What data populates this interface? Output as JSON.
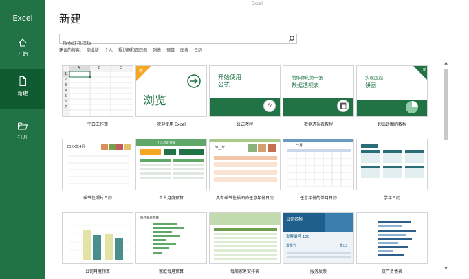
{
  "window": {
    "title": "Excel"
  },
  "sidebar": {
    "brand": "Excel",
    "items": [
      {
        "label": "开始",
        "icon": "home-icon",
        "active": false
      },
      {
        "label": "新建",
        "icon": "new-document-icon",
        "active": true
      },
      {
        "label": "打开",
        "icon": "open-folder-icon",
        "active": false
      }
    ]
  },
  "main": {
    "title": "新建",
    "search": {
      "placeholder": "搜索联机模板",
      "icon": "search-icon"
    },
    "suggestions": {
      "label": "建议的搜索:",
      "items": [
        "商业版",
        "个人",
        "规划器和跟踪器",
        "列表",
        "预算",
        "图表",
        "日历"
      ]
    }
  },
  "blank_workbook": {
    "col_headers": [
      "A",
      "B",
      "C"
    ],
    "row_headers": [
      "1",
      "2",
      "3",
      "4",
      "5",
      "6",
      "7"
    ]
  },
  "featured": {
    "tour": {
      "badge": "新",
      "title": "浏览"
    },
    "formula": {
      "line1": "开始使用",
      "line2": "公式",
      "icon": "fx"
    },
    "pivot": {
      "line1": "制作你的第一张",
      "line2": "数据透视表"
    },
    "pie": {
      "line1": "实现超越",
      "line2": "饼图"
    }
  },
  "calendar_previews": {
    "photo": "20XX年4月",
    "family": "20__年",
    "monthly": "一月",
    "budget_header": "个人月度预算"
  },
  "row3_previews": {
    "monthly_budget": "每月家庭预算",
    "company": {
      "name": "公司名称",
      "invoice": "发票编号 100",
      "seller": "发票方",
      "buyer": "售出"
    }
  },
  "templates": [
    {
      "caption": "空白工作簿"
    },
    {
      "caption": "欢迎使用 Excel"
    },
    {
      "caption": "公式教程"
    },
    {
      "caption": "数据透视表教程"
    },
    {
      "caption": "超出饼图的教程"
    },
    {
      "caption": "季节性照片日历"
    },
    {
      "caption": "个人月度预算"
    },
    {
      "caption": "具有季节性插图的任意年份日历"
    },
    {
      "caption": "任意年份的单月日历"
    },
    {
      "caption": "学年日历"
    },
    {
      "caption": "公司月度预算"
    },
    {
      "caption": "家庭每月预算"
    },
    {
      "caption": "每周家务安排表"
    },
    {
      "caption": "服务发票"
    },
    {
      "caption": "资产负债表"
    }
  ],
  "colors": {
    "brand": "#217346",
    "brand_dark": "#0e5c2f",
    "accent_orange": "#f5a623",
    "chart_yellow": "#e3e3a6",
    "chart_teal": "#4a8f8c",
    "invoice_blue": "#1f5f8b"
  }
}
